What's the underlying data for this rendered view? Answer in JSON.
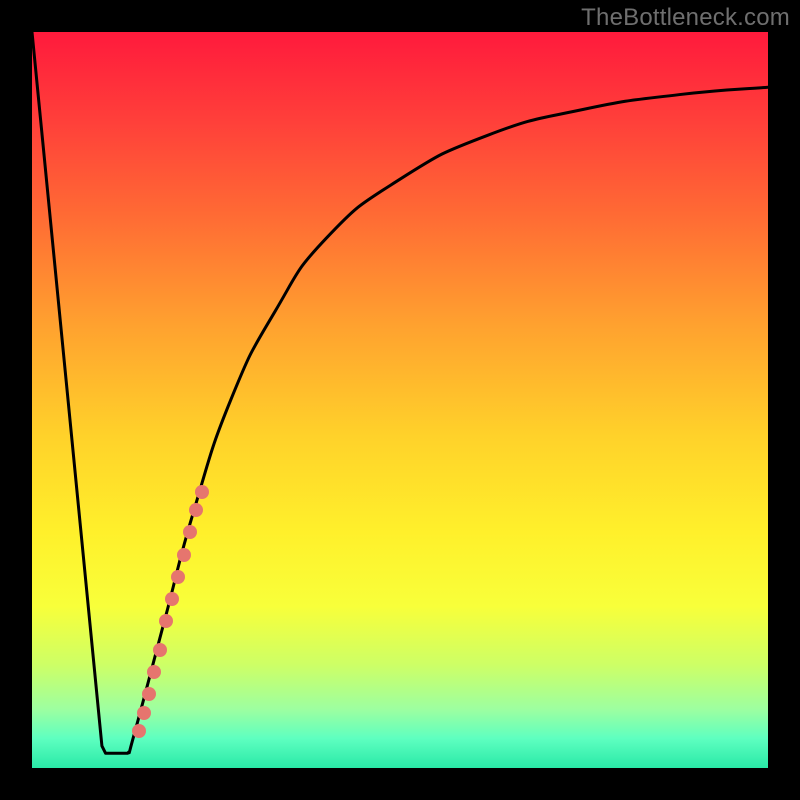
{
  "attribution": {
    "text": "TheBottleneck.com"
  },
  "chart_data": {
    "type": "line",
    "title": "",
    "xlabel": "",
    "ylabel": "",
    "x_range": [
      0,
      100
    ],
    "y_range": [
      0,
      100
    ],
    "gradient_stops": [
      {
        "pos": 0.0,
        "color": "#ff1a3c"
      },
      {
        "pos": 0.12,
        "color": "#ff3f3a"
      },
      {
        "pos": 0.25,
        "color": "#ff6b34"
      },
      {
        "pos": 0.4,
        "color": "#ffa22f"
      },
      {
        "pos": 0.55,
        "color": "#ffd22a"
      },
      {
        "pos": 0.68,
        "color": "#fff02b"
      },
      {
        "pos": 0.78,
        "color": "#f8ff3a"
      },
      {
        "pos": 0.86,
        "color": "#cdff66"
      },
      {
        "pos": 0.92,
        "color": "#9dffa0"
      },
      {
        "pos": 0.96,
        "color": "#5effc0"
      },
      {
        "pos": 1.0,
        "color": "#29e9a7"
      }
    ],
    "series": [
      {
        "name": "bottleneck-curve",
        "points": [
          {
            "x": 0.0,
            "y": 100.0
          },
          {
            "x": 9.5,
            "y": 3.0
          },
          {
            "x": 10.0,
            "y": 2.0
          },
          {
            "x": 12.0,
            "y": 2.0
          },
          {
            "x": 13.0,
            "y": 2.0
          },
          {
            "x": 14.0,
            "y": 5.0
          },
          {
            "x": 18.0,
            "y": 20.0
          },
          {
            "x": 22.0,
            "y": 35.0
          },
          {
            "x": 27.0,
            "y": 50.0
          },
          {
            "x": 33.0,
            "y": 62.0
          },
          {
            "x": 40.0,
            "y": 72.0
          },
          {
            "x": 50.0,
            "y": 80.0
          },
          {
            "x": 62.0,
            "y": 86.0
          },
          {
            "x": 75.0,
            "y": 89.5
          },
          {
            "x": 88.0,
            "y": 91.5
          },
          {
            "x": 100.0,
            "y": 92.5
          }
        ]
      }
    ],
    "marker_cluster": {
      "name": "highlight-dots",
      "color": "#e6756e",
      "points": [
        {
          "x": 14.5,
          "y": 5.0
        },
        {
          "x": 15.2,
          "y": 7.5
        },
        {
          "x": 15.9,
          "y": 10.0
        },
        {
          "x": 16.6,
          "y": 13.0
        },
        {
          "x": 17.4,
          "y": 16.0
        },
        {
          "x": 18.2,
          "y": 20.0
        },
        {
          "x": 19.0,
          "y": 23.0
        },
        {
          "x": 19.8,
          "y": 26.0
        },
        {
          "x": 20.6,
          "y": 29.0
        },
        {
          "x": 21.5,
          "y": 32.0
        },
        {
          "x": 22.3,
          "y": 35.0
        },
        {
          "x": 23.1,
          "y": 37.5
        }
      ]
    }
  }
}
